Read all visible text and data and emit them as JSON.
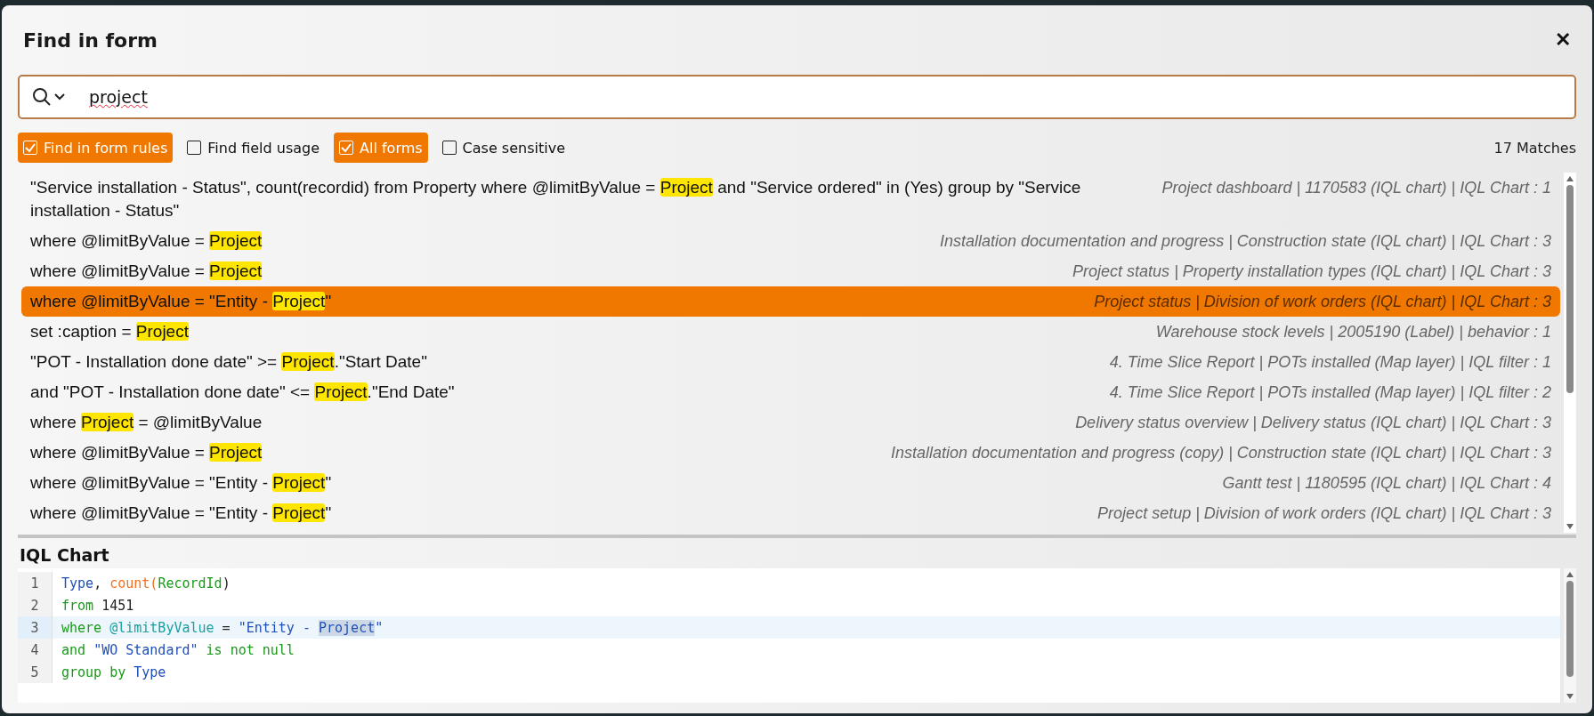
{
  "dialog": {
    "title": "Find in form",
    "close": "✕"
  },
  "search": {
    "value": "project"
  },
  "options": [
    {
      "label": "Find in form rules",
      "checked": true
    },
    {
      "label": "Find field usage",
      "checked": false
    },
    {
      "label": "All forms",
      "checked": true
    },
    {
      "label": "Case sensitive",
      "checked": false
    }
  ],
  "match_count": "17 Matches",
  "results": [
    {
      "selected": false,
      "query": [
        {
          "text": "\"Service installation - Status\", count(recordid) from Property where @limitByValue = ",
          "match": false
        },
        {
          "text": "Project",
          "match": true
        },
        {
          "text": " and \"Service ordered\" in (Yes) group by \"Service installation - Status\"",
          "match": false
        }
      ],
      "location": "Project dashboard | 1170583 (IQL chart) | IQL Chart : 1"
    },
    {
      "selected": false,
      "query": [
        {
          "text": "where @limitByValue = ",
          "match": false
        },
        {
          "text": "Project",
          "match": true
        }
      ],
      "location": "Installation documentation and progress | Construction state (IQL chart) | IQL Chart : 3"
    },
    {
      "selected": false,
      "query": [
        {
          "text": "where @limitByValue = ",
          "match": false
        },
        {
          "text": "Project",
          "match": true
        }
      ],
      "location": "Project status | Property installation types (IQL chart) | IQL Chart : 3"
    },
    {
      "selected": true,
      "query": [
        {
          "text": "where @limitByValue = \"Entity - ",
          "match": false
        },
        {
          "text": "Project",
          "match": true
        },
        {
          "text": "\"",
          "match": false
        }
      ],
      "location": "Project status | Division of work orders (IQL chart) | IQL Chart : 3"
    },
    {
      "selected": false,
      "query": [
        {
          "text": "set :caption = ",
          "match": false
        },
        {
          "text": "Project",
          "match": true
        }
      ],
      "location": "Warehouse stock levels | 2005190 (Label) | behavior : 1"
    },
    {
      "selected": false,
      "query": [
        {
          "text": "\"POT - Installation done date\" >= ",
          "match": false
        },
        {
          "text": "Project",
          "match": true
        },
        {
          "text": ".\"Start Date\"",
          "match": false
        }
      ],
      "location": "4. Time Slice Report | POTs installed (Map layer) | IQL filter : 1"
    },
    {
      "selected": false,
      "query": [
        {
          "text": "and \"POT - Installation done date\" <= ",
          "match": false
        },
        {
          "text": "Project",
          "match": true
        },
        {
          "text": ".\"End Date\"",
          "match": false
        }
      ],
      "location": "4. Time Slice Report | POTs installed (Map layer) | IQL filter : 2"
    },
    {
      "selected": false,
      "query": [
        {
          "text": "where ",
          "match": false
        },
        {
          "text": "Project",
          "match": true
        },
        {
          "text": " = @limitByValue",
          "match": false
        }
      ],
      "location": "Delivery status overview | Delivery status (IQL chart) | IQL Chart : 3"
    },
    {
      "selected": false,
      "query": [
        {
          "text": "where @limitByValue = ",
          "match": false
        },
        {
          "text": "Project",
          "match": true
        }
      ],
      "location": "Installation documentation and progress (copy) | Construction state (IQL chart) | IQL Chart : 3"
    },
    {
      "selected": false,
      "query": [
        {
          "text": "where @limitByValue = \"Entity - ",
          "match": false
        },
        {
          "text": "Project",
          "match": true
        },
        {
          "text": "\"",
          "match": false
        }
      ],
      "location": "Gantt test | 1180595 (IQL chart) | IQL Chart : 4"
    },
    {
      "selected": false,
      "query": [
        {
          "text": "where @limitByValue = \"Entity - ",
          "match": false
        },
        {
          "text": "Project",
          "match": true
        },
        {
          "text": "\"",
          "match": false
        }
      ],
      "location": "Project setup | Division of work orders (IQL chart) | IQL Chart : 3"
    }
  ],
  "preview": {
    "title": "IQL Chart",
    "lines": [
      {
        "number": "1",
        "active": false,
        "tokens": [
          {
            "text": "Type",
            "kind": "identifier"
          },
          {
            "text": ", ",
            "kind": "plain"
          },
          {
            "text": "count(",
            "kind": "function"
          },
          {
            "text": "RecordId",
            "kind": "keyword"
          },
          {
            "text": ")",
            "kind": "plain"
          }
        ]
      },
      {
        "number": "2",
        "active": false,
        "tokens": [
          {
            "text": "from",
            "kind": "keyword"
          },
          {
            "text": " 1451",
            "kind": "plain"
          }
        ]
      },
      {
        "number": "3",
        "active": true,
        "tokens": [
          {
            "text": "where ",
            "kind": "keyword"
          },
          {
            "text": "@limitByValue",
            "kind": "variable"
          },
          {
            "text": " = ",
            "kind": "plain"
          },
          {
            "text": "\"Entity - ",
            "kind": "string"
          },
          {
            "text": "Project",
            "kind": "selection"
          },
          {
            "text": "\"",
            "kind": "string"
          }
        ]
      },
      {
        "number": "4",
        "active": false,
        "tokens": [
          {
            "text": "and ",
            "kind": "keyword"
          },
          {
            "text": "\"WO Standard\"",
            "kind": "string"
          },
          {
            "text": " is not null",
            "kind": "keyword"
          }
        ]
      },
      {
        "number": "5",
        "active": false,
        "tokens": [
          {
            "text": "group by ",
            "kind": "keyword"
          },
          {
            "text": "Type",
            "kind": "identifier"
          }
        ]
      }
    ]
  }
}
